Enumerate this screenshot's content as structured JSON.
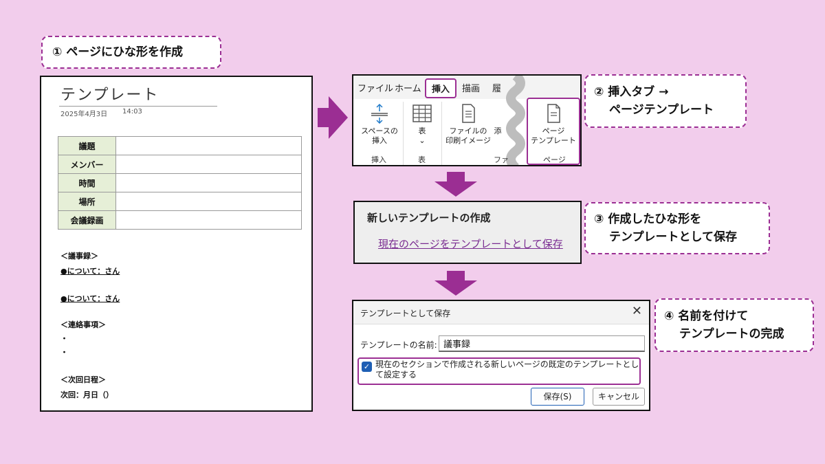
{
  "step1": {
    "callout": "① ページにひな形を作成",
    "doc": {
      "title": "テンプレート",
      "date": "2025年4月3日",
      "time": "14:03",
      "table_rows": [
        "議題",
        "メンバー",
        "時間",
        "場所",
        "会議録画"
      ],
      "notes": [
        "＜議事録＞",
        "●について：さん",
        "●について：さん",
        "＜連絡事項＞",
        "・",
        "・",
        "＜次回日程＞",
        "次回：月日（）"
      ]
    }
  },
  "step2": {
    "callout_line1": "② 挿入タブ →",
    "callout_line2": "ページテンプレート",
    "ribbon": {
      "tabs": [
        "ファイル",
        "ホーム",
        "挿入",
        "描画",
        "履"
      ],
      "btn_space": "スペースの\n挿入",
      "btn_table": "表",
      "btn_printout": "ファイルの\n印刷イメージ",
      "btn_attach": "添",
      "btn_page_template": "ページ\nテンプレート",
      "chevron": "⌄",
      "group_insert": "挿入",
      "group_table": "表",
      "group_file": "ファ",
      "group_page": "ページ"
    }
  },
  "step3": {
    "panel_title": "新しいテンプレートの作成",
    "link": "現在のページをテンプレートとして保存",
    "callout_line1": "③ 作成したひな形を",
    "callout_line2": "テンプレートとして保存"
  },
  "step4": {
    "dialog_title": "テンプレートとして保存",
    "close": "✕",
    "name_label": "テンプレートの名前:",
    "name_value": "議事録",
    "checkbox_checked": true,
    "checkbox_mark": "✓",
    "checkbox_label": "現在のセクションで作成される新しいページの既定のテンプレートとして設定する",
    "save_button": "保存(S)",
    "cancel_button": "キャンセル",
    "callout_line1": "④ 名前を付けて",
    "callout_line2": "テンプレートの完成"
  },
  "colors": {
    "background": "#f2cdec",
    "accent": "#9b2e93",
    "table_header": "#e6efd7",
    "link": "#7a2c91",
    "checkbox": "#1f5fb4"
  }
}
